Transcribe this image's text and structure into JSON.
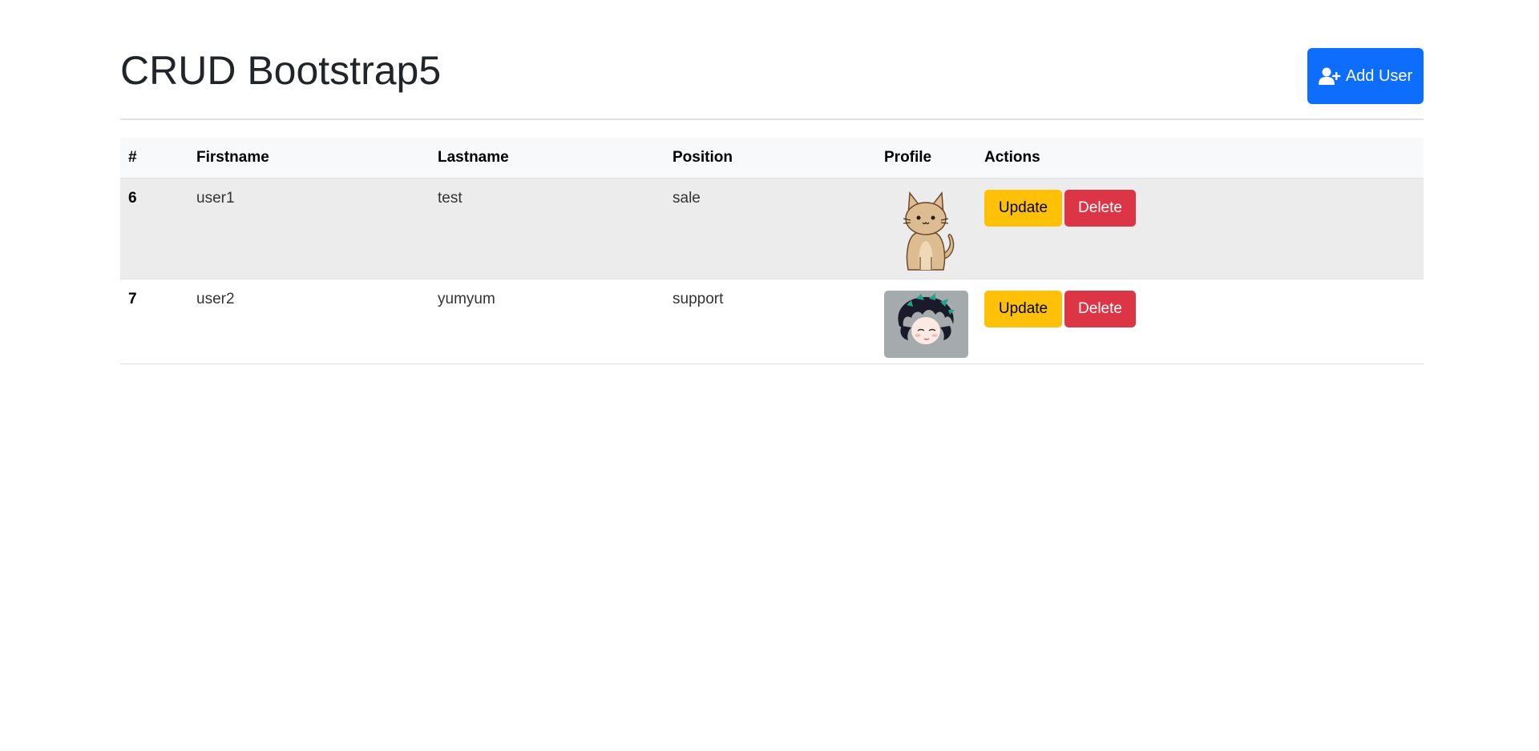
{
  "header": {
    "title": "CRUD Bootstrap5",
    "add_button_label": "Add User"
  },
  "table": {
    "columns": [
      "#",
      "Firstname",
      "Lastname",
      "Position",
      "Profile",
      "Actions"
    ],
    "rows": [
      {
        "id": "6",
        "firstname": "user1",
        "lastname": "test",
        "position": "sale",
        "profile": "cat-avatar"
      },
      {
        "id": "7",
        "firstname": "user2",
        "lastname": "yumyum",
        "position": "support",
        "profile": "anime-boy-avatar"
      }
    ],
    "update_label": "Update",
    "delete_label": "Delete"
  },
  "colors": {
    "primary": "#0d6efd",
    "warning": "#ffc107",
    "danger": "#dc3545"
  },
  "icons": {
    "add_user": "person-plus-icon"
  }
}
